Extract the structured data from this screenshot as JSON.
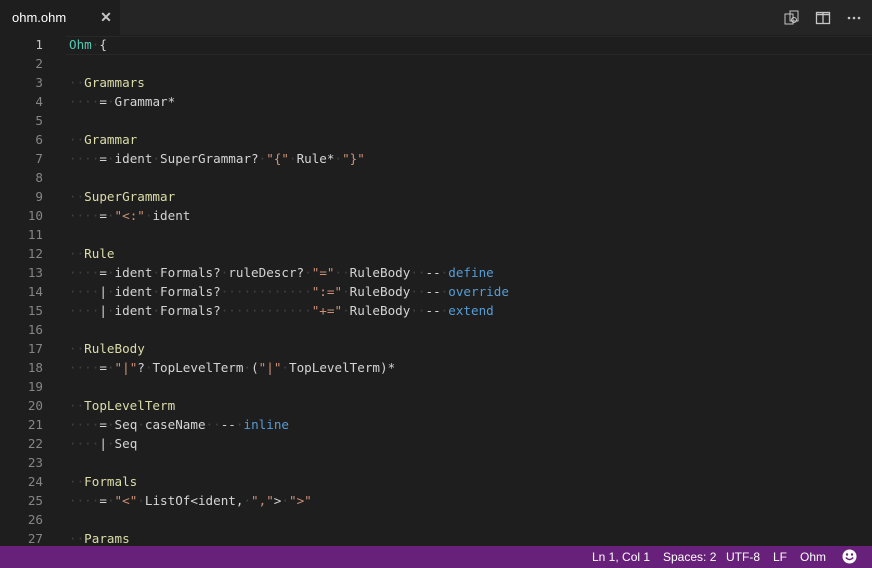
{
  "tab": {
    "title": "ohm.ohm",
    "close_icon": "close-icon"
  },
  "toolbar": {
    "icons": [
      "open-changes-icon",
      "split-editor-icon",
      "more-actions-icon"
    ]
  },
  "editor": {
    "active_line": 1,
    "lines": [
      {
        "n": "1",
        "tokens": [
          [
            "kw",
            "Ohm"
          ],
          [
            "ws",
            "·"
          ],
          [
            "op",
            "{"
          ]
        ]
      },
      {
        "n": "2",
        "tokens": []
      },
      {
        "n": "3",
        "tokens": [
          [
            "ws",
            "··"
          ],
          [
            "rn",
            "Grammars"
          ]
        ]
      },
      {
        "n": "4",
        "tokens": [
          [
            "ws",
            "····"
          ],
          [
            "op",
            "="
          ],
          [
            "ws",
            "·"
          ],
          [
            "op",
            "Grammar*"
          ]
        ]
      },
      {
        "n": "5",
        "tokens": []
      },
      {
        "n": "6",
        "tokens": [
          [
            "ws",
            "··"
          ],
          [
            "rn",
            "Grammar"
          ]
        ]
      },
      {
        "n": "7",
        "tokens": [
          [
            "ws",
            "····"
          ],
          [
            "op",
            "="
          ],
          [
            "ws",
            "·"
          ],
          [
            "op",
            "ident"
          ],
          [
            "ws",
            "·"
          ],
          [
            "op",
            "SuperGrammar?"
          ],
          [
            "ws",
            "·"
          ],
          [
            "str",
            "\"{\""
          ],
          [
            "ws",
            "·"
          ],
          [
            "op",
            "Rule*"
          ],
          [
            "ws",
            "·"
          ],
          [
            "str",
            "\"}\""
          ]
        ]
      },
      {
        "n": "8",
        "tokens": []
      },
      {
        "n": "9",
        "tokens": [
          [
            "ws",
            "··"
          ],
          [
            "rn",
            "SuperGrammar"
          ]
        ]
      },
      {
        "n": "10",
        "tokens": [
          [
            "ws",
            "····"
          ],
          [
            "op",
            "="
          ],
          [
            "ws",
            "·"
          ],
          [
            "str",
            "\"<:\""
          ],
          [
            "ws",
            "·"
          ],
          [
            "op",
            "ident"
          ]
        ]
      },
      {
        "n": "11",
        "tokens": []
      },
      {
        "n": "12",
        "tokens": [
          [
            "ws",
            "··"
          ],
          [
            "rn",
            "Rule"
          ]
        ]
      },
      {
        "n": "13",
        "tokens": [
          [
            "ws",
            "····"
          ],
          [
            "op",
            "="
          ],
          [
            "ws",
            "·"
          ],
          [
            "op",
            "ident"
          ],
          [
            "ws",
            "·"
          ],
          [
            "op",
            "Formals?"
          ],
          [
            "ws",
            "·"
          ],
          [
            "op",
            "ruleDescr?"
          ],
          [
            "ws",
            "·"
          ],
          [
            "str",
            "\"=\""
          ],
          [
            "ws",
            "··"
          ],
          [
            "op",
            "RuleBody"
          ],
          [
            "ws",
            "··"
          ],
          [
            "op",
            "--"
          ],
          [
            "ws",
            "·"
          ],
          [
            "cm",
            "define"
          ]
        ]
      },
      {
        "n": "14",
        "tokens": [
          [
            "ws",
            "····"
          ],
          [
            "op",
            "|"
          ],
          [
            "ws",
            "·"
          ],
          [
            "op",
            "ident"
          ],
          [
            "ws",
            "·"
          ],
          [
            "op",
            "Formals?"
          ],
          [
            "ws",
            "············"
          ],
          [
            "str",
            "\":=\""
          ],
          [
            "ws",
            "·"
          ],
          [
            "op",
            "RuleBody"
          ],
          [
            "ws",
            "··"
          ],
          [
            "op",
            "--"
          ],
          [
            "ws",
            "·"
          ],
          [
            "cm",
            "override"
          ]
        ]
      },
      {
        "n": "15",
        "tokens": [
          [
            "ws",
            "····"
          ],
          [
            "op",
            "|"
          ],
          [
            "ws",
            "·"
          ],
          [
            "op",
            "ident"
          ],
          [
            "ws",
            "·"
          ],
          [
            "op",
            "Formals?"
          ],
          [
            "ws",
            "············"
          ],
          [
            "str",
            "\"+=\""
          ],
          [
            "ws",
            "·"
          ],
          [
            "op",
            "RuleBody"
          ],
          [
            "ws",
            "··"
          ],
          [
            "op",
            "--"
          ],
          [
            "ws",
            "·"
          ],
          [
            "cm",
            "extend"
          ]
        ]
      },
      {
        "n": "16",
        "tokens": []
      },
      {
        "n": "17",
        "tokens": [
          [
            "ws",
            "··"
          ],
          [
            "rn",
            "RuleBody"
          ]
        ]
      },
      {
        "n": "18",
        "tokens": [
          [
            "ws",
            "····"
          ],
          [
            "op",
            "="
          ],
          [
            "ws",
            "·"
          ],
          [
            "str",
            "\"|\""
          ],
          [
            "op",
            "?"
          ],
          [
            "ws",
            "·"
          ],
          [
            "op",
            "TopLevelTerm"
          ],
          [
            "ws",
            "·"
          ],
          [
            "op",
            "("
          ],
          [
            "str",
            "\"|\""
          ],
          [
            "ws",
            "·"
          ],
          [
            "op",
            "TopLevelTerm)*"
          ]
        ]
      },
      {
        "n": "19",
        "tokens": []
      },
      {
        "n": "20",
        "tokens": [
          [
            "ws",
            "··"
          ],
          [
            "rn",
            "TopLevelTerm"
          ]
        ]
      },
      {
        "n": "21",
        "tokens": [
          [
            "ws",
            "····"
          ],
          [
            "op",
            "="
          ],
          [
            "ws",
            "·"
          ],
          [
            "op",
            "Seq"
          ],
          [
            "ws",
            "·"
          ],
          [
            "op",
            "caseName"
          ],
          [
            "ws",
            "··"
          ],
          [
            "op",
            "--"
          ],
          [
            "ws",
            "·"
          ],
          [
            "cm",
            "inline"
          ]
        ]
      },
      {
        "n": "22",
        "tokens": [
          [
            "ws",
            "····"
          ],
          [
            "op",
            "|"
          ],
          [
            "ws",
            "·"
          ],
          [
            "op",
            "Seq"
          ]
        ]
      },
      {
        "n": "23",
        "tokens": []
      },
      {
        "n": "24",
        "tokens": [
          [
            "ws",
            "··"
          ],
          [
            "rn",
            "Formals"
          ]
        ]
      },
      {
        "n": "25",
        "tokens": [
          [
            "ws",
            "····"
          ],
          [
            "op",
            "="
          ],
          [
            "ws",
            "·"
          ],
          [
            "str",
            "\"<\""
          ],
          [
            "ws",
            "·"
          ],
          [
            "op",
            "ListOf<ident,"
          ],
          [
            "ws",
            "·"
          ],
          [
            "str",
            "\",\""
          ],
          [
            "op",
            ">"
          ],
          [
            "ws",
            "·"
          ],
          [
            "str",
            "\">\""
          ]
        ]
      },
      {
        "n": "26",
        "tokens": []
      },
      {
        "n": "27",
        "tokens": [
          [
            "ws",
            "··"
          ],
          [
            "rn",
            "Params"
          ]
        ]
      }
    ]
  },
  "status": {
    "cursor": "Ln 1, Col 1",
    "spaces": "Spaces: 2",
    "encoding": "UTF-8",
    "eol": "LF",
    "language": "Ohm",
    "feedback_icon": "smiley-icon"
  }
}
